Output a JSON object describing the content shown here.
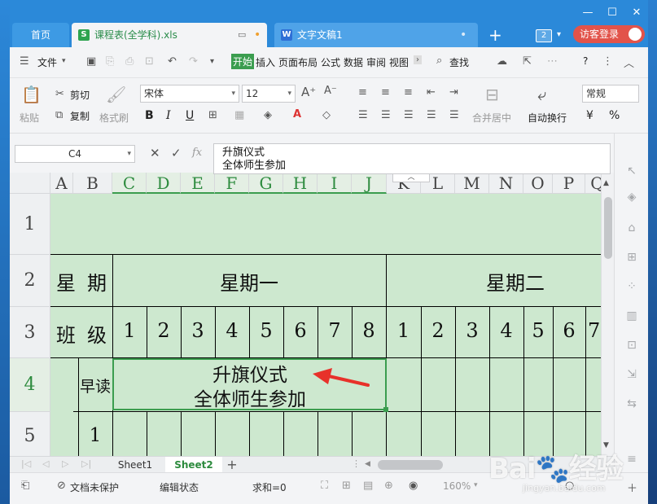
{
  "titlebar": {
    "home_tab": "首页",
    "active_doc": "课程表(全学科).xls",
    "other_doc": "文字文稿1",
    "tab_count": "2",
    "login": "访客登录",
    "colors": {
      "titlebar_bg": "#2b89d9",
      "login_bg": "#e2534a"
    }
  },
  "menubar": {
    "file": "文件",
    "items": [
      "开始",
      "插入",
      "页面布局",
      "公式",
      "数据",
      "审阅",
      "视图"
    ],
    "active": "开始",
    "search": "查找",
    "help": "?"
  },
  "ribbon": {
    "paste": "粘贴",
    "cut": "剪切",
    "copy": "复制",
    "format_painter": "格式刷",
    "font_name": "宋体",
    "font_size": "12",
    "bold": "B",
    "italic": "I",
    "underline": "U",
    "merge_center": "合并居中",
    "wrap_text": "自动换行",
    "number_format": "常规",
    "percent": "%"
  },
  "formula_bar": {
    "name_box": "C4",
    "fx": "fx",
    "line1": "升旗仪式",
    "line2": "全体师生参加"
  },
  "grid": {
    "columns": [
      "A",
      "B",
      "C",
      "D",
      "E",
      "F",
      "G",
      "H",
      "I",
      "J",
      "K",
      "L",
      "M",
      "N",
      "O",
      "P",
      "Q"
    ],
    "rows": [
      "1",
      "2",
      "3",
      "4",
      "5"
    ],
    "row2": {
      "label_a": "星",
      "label_b": "期",
      "day1": "星期一",
      "day2": "星期二"
    },
    "row3": {
      "label_a": "班",
      "label_b": "级",
      "classes": [
        "1",
        "2",
        "3",
        "4",
        "5",
        "6",
        "7",
        "8",
        "1",
        "2",
        "3",
        "4",
        "5",
        "6",
        "7"
      ]
    },
    "row4": {
      "label_b": "早读",
      "merged_line1": "升旗仪式",
      "merged_line2": "全体师生参加"
    },
    "row5": {
      "label_b": "1"
    },
    "cell_color": "#cde8cf"
  },
  "sheets": {
    "tabs": [
      "Sheet1",
      "Sheet2"
    ],
    "active": "Sheet2",
    "add": "+"
  },
  "statusbar": {
    "protect": "文档未保护",
    "mode": "编辑状态",
    "sum": "求和=0",
    "zoom": "160%"
  },
  "watermark": {
    "brand": "Bai",
    "brand_suffix": "经验",
    "url": "jingyan.baidu.com"
  }
}
